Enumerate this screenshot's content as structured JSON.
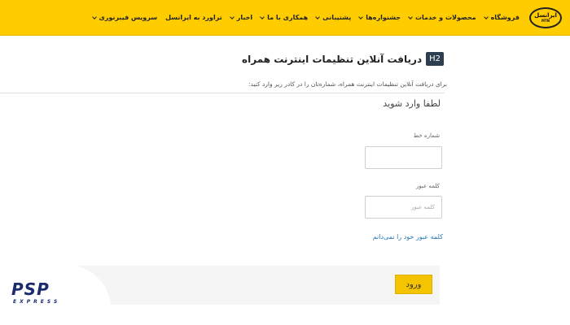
{
  "navbar": {
    "logo_text": "ایرانسل",
    "logo_sub": "MTN",
    "items": [
      {
        "label": "فروشگاه",
        "dropdown": true
      },
      {
        "label": "محصولات و خدمات",
        "dropdown": true
      },
      {
        "label": "جشنواره‌ها",
        "dropdown": true
      },
      {
        "label": "پشتیبانی",
        "dropdown": true
      },
      {
        "label": "همکاری با ما",
        "dropdown": true
      },
      {
        "label": "اخبار",
        "dropdown": true
      },
      {
        "label": "تراورد به ایرانسل",
        "dropdown": false
      },
      {
        "label": "سرویس فیبرنوری",
        "dropdown": true
      }
    ]
  },
  "main": {
    "heading_badge": "H2",
    "title": "دریافت آنلاین تنظیمات اینترنت همراه",
    "intro": "برای دریافت آنلاین تنظیمات اینترنت همراه، شماره‌تان را در کادر زیر وارد کنید:"
  },
  "login": {
    "title": "لطفا وارد شوید",
    "phone_label": "شماره خط",
    "phone_value": "",
    "password_label": "کلمه عبور",
    "password_placeholder": "کلمه عبور",
    "forgot_label": "کلمه عبور خود را نمی‌دانم",
    "submit_label": "ورود"
  },
  "watermark": {
    "brand": "PSP",
    "sub": "EXPRESS",
    "color": "#1a2c6e"
  },
  "colors": {
    "accent": "#ffcc00",
    "button": "#f5c400",
    "link": "#2a7ab8"
  }
}
